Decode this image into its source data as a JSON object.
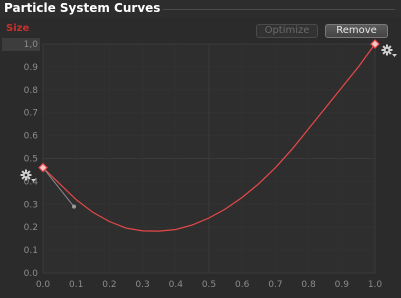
{
  "window": {
    "title": "Particle System Curves"
  },
  "curve": {
    "name": "Size",
    "color": "#e84848"
  },
  "buttons": {
    "optimize": "Optimize",
    "remove": "Remove"
  },
  "icons": {
    "start_wrap": "gear-icon",
    "end_wrap": "gear-icon"
  },
  "axes": {
    "y_ticks": [
      "1,0",
      "0.9",
      "0.8",
      "0.7",
      "0.6",
      "0.5",
      "0.4",
      "0.3",
      "0.2",
      "0.1",
      "0.0"
    ],
    "x_ticks": [
      "0.0",
      "0.1",
      "0.2",
      "0.3",
      "0.4",
      "0.5",
      "0.6",
      "0.7",
      "0.8",
      "0.9",
      "1.0"
    ],
    "xlim": [
      0,
      1
    ],
    "ylim": [
      0,
      1
    ]
  },
  "chart_data": {
    "type": "line",
    "keys": [
      {
        "time": 0.0,
        "value": 0.46
      },
      {
        "time": 1.0,
        "value": 1.0
      }
    ],
    "curve_points": {
      "x": [
        0.0,
        0.05,
        0.1,
        0.15,
        0.2,
        0.25,
        0.3,
        0.35,
        0.4,
        0.45,
        0.5,
        0.55,
        0.6,
        0.65,
        0.7,
        0.75,
        0.8,
        0.85,
        0.9,
        0.95,
        1.0
      ],
      "y": [
        0.46,
        0.39,
        0.32,
        0.265,
        0.225,
        0.196,
        0.184,
        0.183,
        0.19,
        0.21,
        0.24,
        0.28,
        0.33,
        0.39,
        0.46,
        0.54,
        0.63,
        0.72,
        0.81,
        0.9,
        1.0
      ]
    },
    "xlim": [
      0,
      1
    ],
    "ylim": [
      0,
      1
    ]
  }
}
